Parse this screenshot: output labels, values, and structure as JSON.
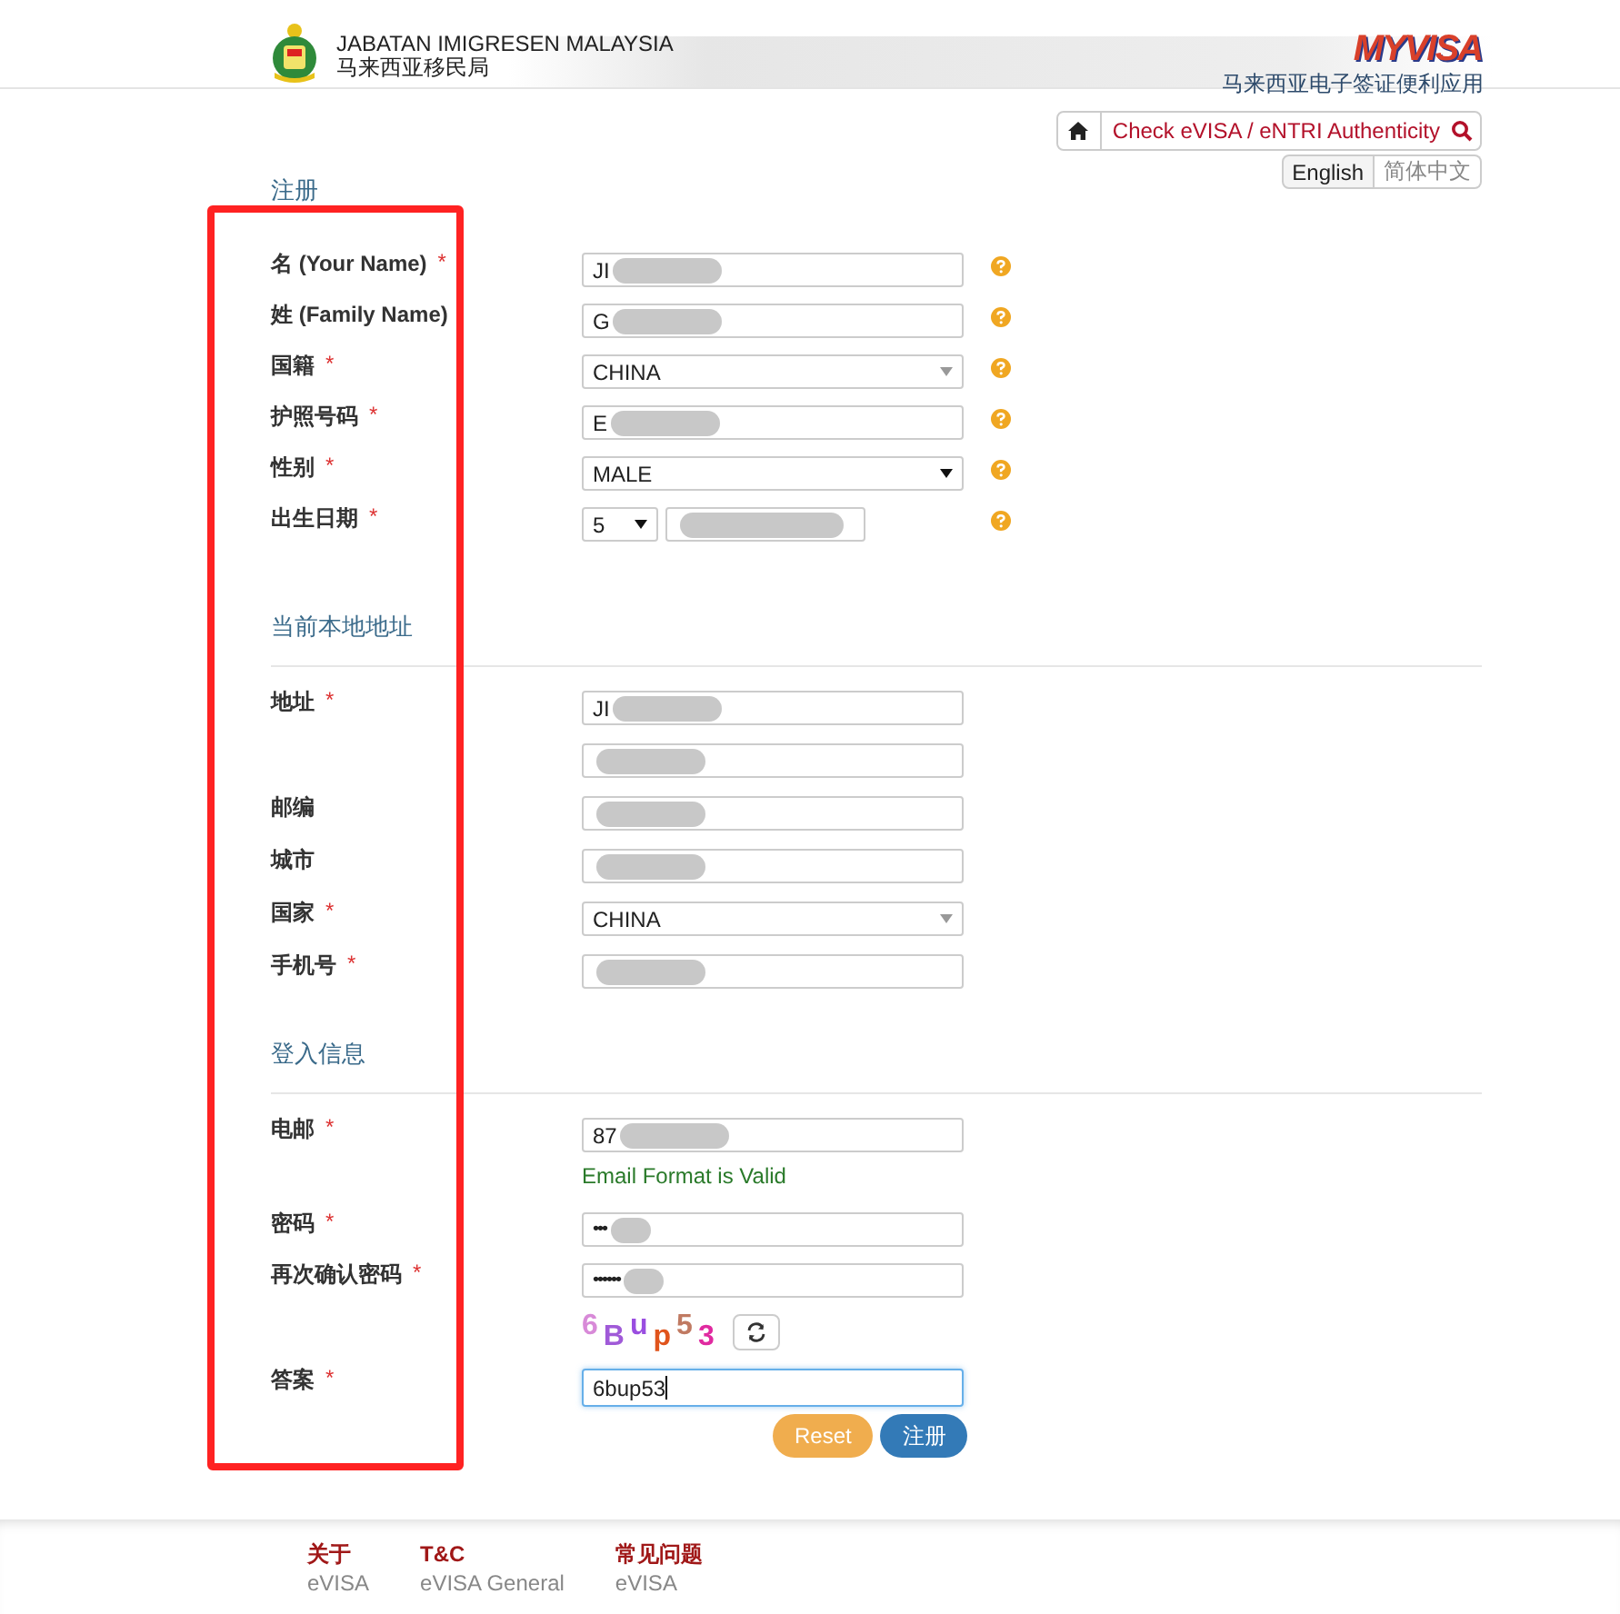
{
  "header": {
    "agency": "JABATAN IMIGRESEN MALAYSIA",
    "agency_cn": "马来西亚移民局",
    "logo": "MYVISA",
    "tagline": "马来西亚电子签证便利应用"
  },
  "topnav": {
    "check": "Check eVISA / eNTRI Authenticity",
    "languages": [
      {
        "label": "English",
        "selected": true
      },
      {
        "label": "简体中文",
        "selected": false
      }
    ]
  },
  "sections": [
    {
      "title": "注册",
      "fields": [
        {
          "kind": "text",
          "label": "名 (Your Name)",
          "required_mark": "*",
          "value": "JI",
          "blurred": true,
          "help": true
        },
        {
          "kind": "text",
          "label": "姓 (Family Name)",
          "value": "G",
          "blurred": true,
          "help": true
        },
        {
          "kind": "select",
          "label": "国籍",
          "required_mark": "*",
          "value": "CHINA",
          "help": true
        },
        {
          "kind": "text",
          "label": "护照号码",
          "required_mark": "*",
          "value": "E",
          "blurred": true,
          "help": true
        },
        {
          "kind": "select-dark",
          "label": "性别",
          "required_mark": "*",
          "value": "MALE",
          "help": true
        },
        {
          "kind": "date",
          "label": "出生日期",
          "required_mark": "*",
          "value": "5",
          "blurred": true,
          "help": true
        }
      ]
    },
    {
      "title": "当前本地地址",
      "fields": [
        {
          "kind": "text",
          "label": "地址",
          "required_mark": "*",
          "value": "JI",
          "blurred": true
        },
        {
          "kind": "text",
          "blurred": true
        },
        {
          "kind": "text",
          "label": "邮编",
          "blurred": true
        },
        {
          "kind": "text",
          "label": "城市",
          "blurred": true
        },
        {
          "kind": "select",
          "label": "国家",
          "required_mark": "*",
          "value": "CHINA"
        },
        {
          "kind": "text",
          "label": "手机号",
          "required_mark": "*",
          "blurred": true
        }
      ]
    },
    {
      "title": "登入信息",
      "fields": [
        {
          "kind": "text",
          "label": "电邮",
          "required_mark": "*",
          "value": "87",
          "blurred": true,
          "note": "Email Format is Valid"
        },
        {
          "kind": "password",
          "label": "密码",
          "required_mark": "*",
          "value": "•••",
          "blurred": true
        },
        {
          "kind": "password",
          "label": "再次确认密码",
          "required_mark": "*",
          "value": "••••••",
          "blurred": true
        },
        {
          "kind": "captcha",
          "chars": [
            {
              "text": "6",
              "color": "#d88ad8"
            },
            {
              "text": "B",
              "color": "#a05ad8"
            },
            {
              "text": "u",
              "color": "#9a4ee0"
            },
            {
              "text": "p",
              "color": "#e0541c"
            },
            {
              "text": "5",
              "color": "#c07a62"
            },
            {
              "text": "3",
              "color": "#e02aa0"
            }
          ]
        },
        {
          "kind": "answer",
          "label": "答案",
          "required_mark": "*",
          "value": "6bup53"
        }
      ]
    }
  ],
  "buttons": [
    {
      "label": "Reset",
      "kind": "reset"
    },
    {
      "label": "注册",
      "kind": "submit"
    }
  ],
  "footer": [
    {
      "title": "关于",
      "links": [
        "eVISA"
      ]
    },
    {
      "title": "T&C",
      "links": [
        "eVISA General"
      ]
    },
    {
      "title": "常见问题",
      "links": [
        "eVISA"
      ]
    }
  ]
}
